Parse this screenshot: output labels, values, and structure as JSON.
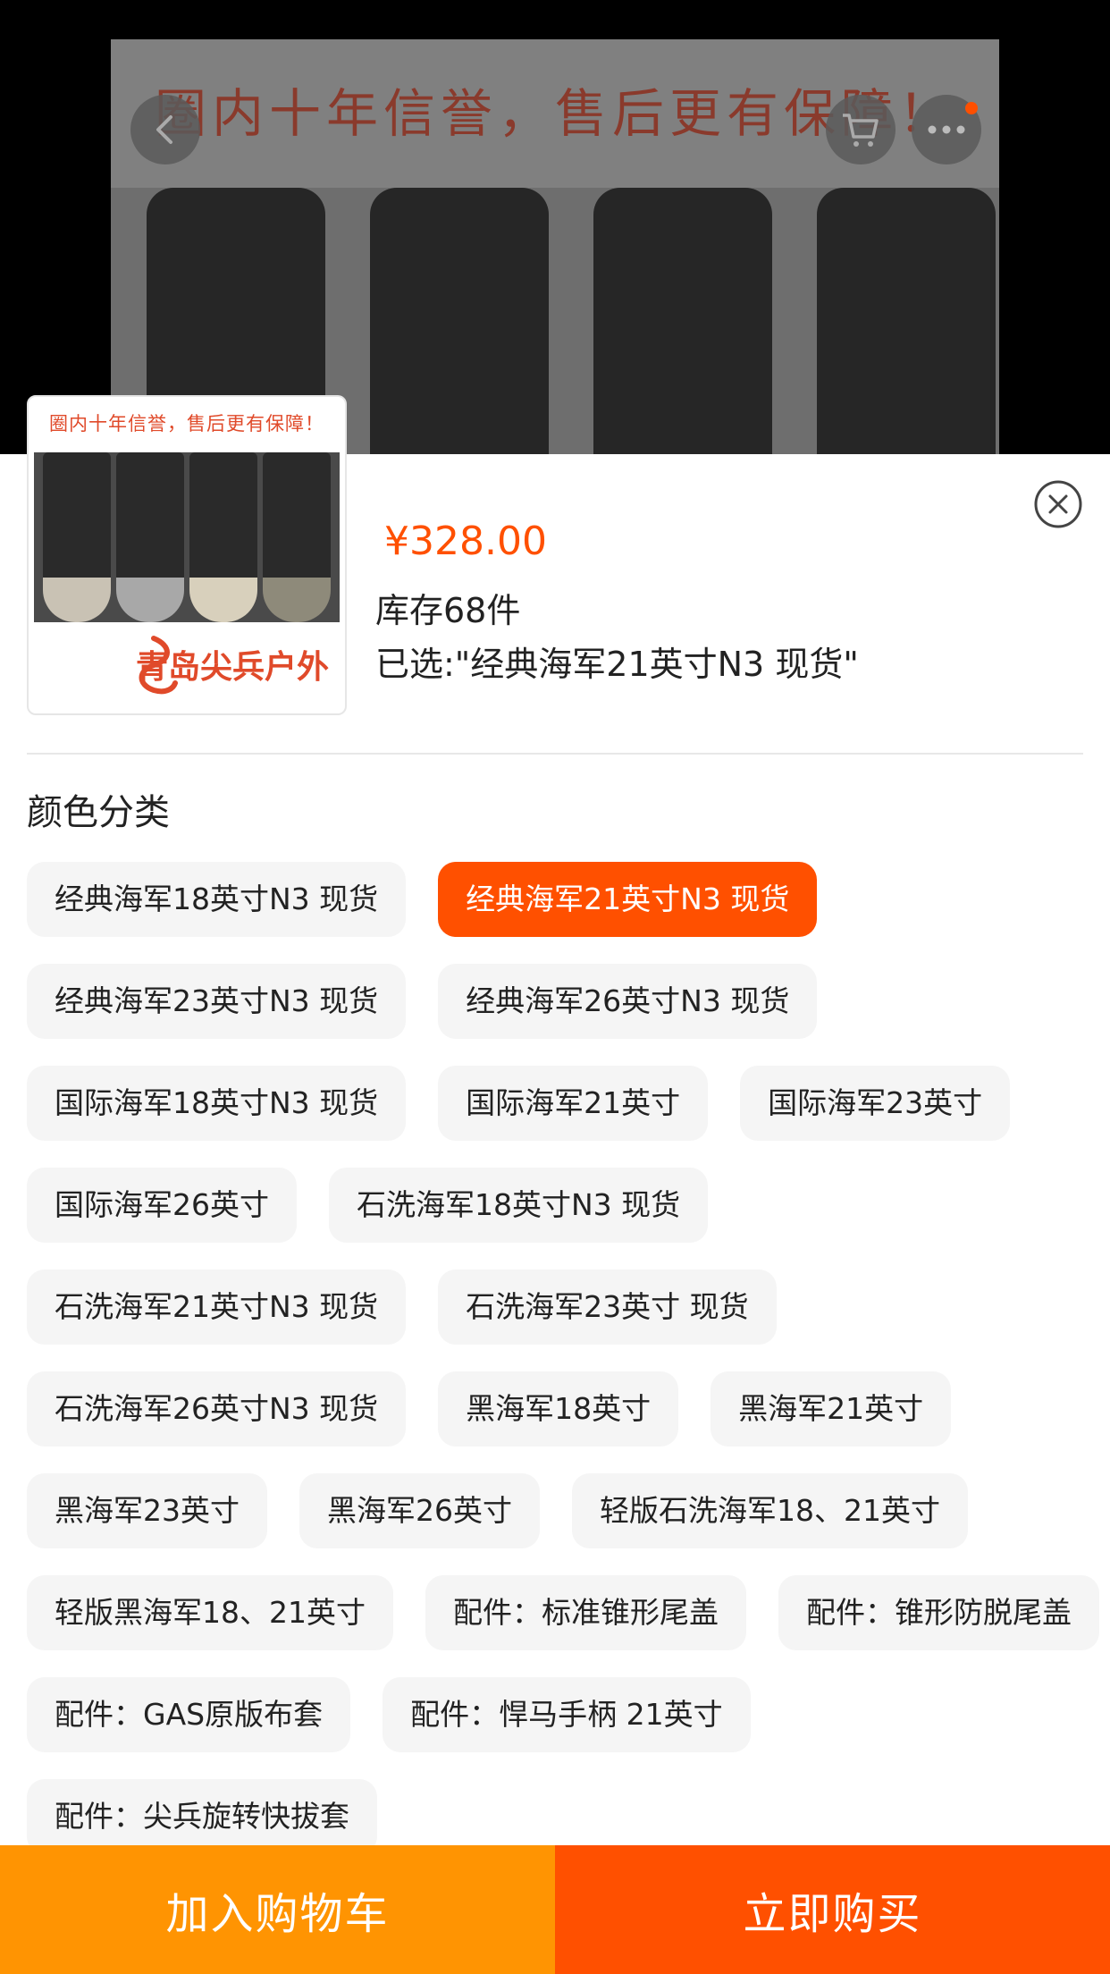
{
  "background_image": {
    "banner_text": "圈内十年信誉，售后更有保障！"
  },
  "nav": {
    "back_icon": "chevron-left-icon",
    "cart_icon": "cart-icon",
    "more_icon": "more-icon"
  },
  "product": {
    "thumbnail_banner": "圈内十年信誉，售后更有保障！",
    "thumbnail_logo": "青岛尖兵户外",
    "price": "¥328.00",
    "stock": "库存68件",
    "selected": "已选:\"经典海军21英寸N3 现货\""
  },
  "sku": {
    "section_title": "颜色分类",
    "options": [
      {
        "label": "经典海军18英寸N3 现货",
        "selected": false
      },
      {
        "label": "经典海军21英寸N3 现货",
        "selected": true
      },
      {
        "label": "经典海军23英寸N3 现货",
        "selected": false
      },
      {
        "label": "经典海军26英寸N3 现货",
        "selected": false
      },
      {
        "label": "国际海军18英寸N3 现货",
        "selected": false
      },
      {
        "label": "国际海军21英寸",
        "selected": false
      },
      {
        "label": "国际海军23英寸",
        "selected": false
      },
      {
        "label": "国际海军26英寸",
        "selected": false
      },
      {
        "label": "石洗海军18英寸N3 现货",
        "selected": false
      },
      {
        "label": "石洗海军21英寸N3 现货",
        "selected": false
      },
      {
        "label": "石洗海军23英寸 现货",
        "selected": false
      },
      {
        "label": "石洗海军26英寸N3 现货",
        "selected": false
      },
      {
        "label": "黑海军18英寸",
        "selected": false
      },
      {
        "label": "黑海军21英寸",
        "selected": false
      },
      {
        "label": "黑海军23英寸",
        "selected": false
      },
      {
        "label": "黑海军26英寸",
        "selected": false
      },
      {
        "label": "轻版石洗海军18、21英寸",
        "selected": false
      },
      {
        "label": "轻版黑海军18、21英寸",
        "selected": false
      },
      {
        "label": "配件：标准锥形尾盖",
        "selected": false
      },
      {
        "label": "配件：锥形防脱尾盖",
        "selected": false
      },
      {
        "label": "配件：GAS原版布套",
        "selected": false
      },
      {
        "label": "配件：悍马手柄 21英寸",
        "selected": false
      },
      {
        "label": "配件：尖兵旋转快拔套",
        "selected": false
      }
    ]
  },
  "actions": {
    "add_to_cart": "加入购物车",
    "buy_now": "立即购买"
  },
  "colors": {
    "accent": "#ff5000",
    "cart_button": "#ff9402",
    "chip_bg": "#f5f5f5"
  }
}
